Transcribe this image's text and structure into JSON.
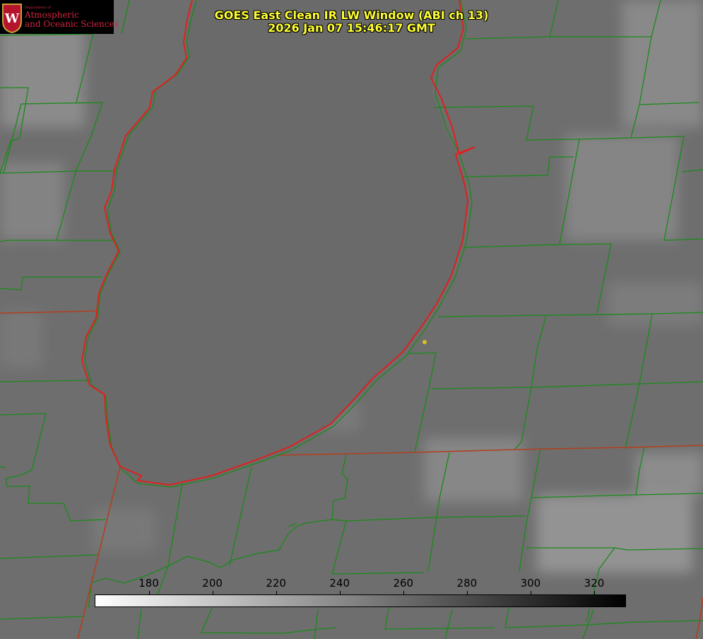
{
  "logo": {
    "department": "Department of",
    "line1": "Atmospheric",
    "line2": "and Oceanic Sciences",
    "emblem": "W"
  },
  "title": {
    "line1": "GOES East Clean IR LW Window (ABI ch 13)",
    "line2": "2026 Jan 07 15:46:17 GMT"
  },
  "colorbar": {
    "min": 163,
    "max": 330,
    "ticks": [
      180,
      200,
      220,
      240,
      260,
      280,
      300,
      320
    ]
  },
  "colors": {
    "lake_border": "#e02020",
    "county_lines": "#1a8a1a",
    "state_line": "#b04020",
    "station_marker": "#d8c020",
    "title_text": "#ffff33"
  }
}
